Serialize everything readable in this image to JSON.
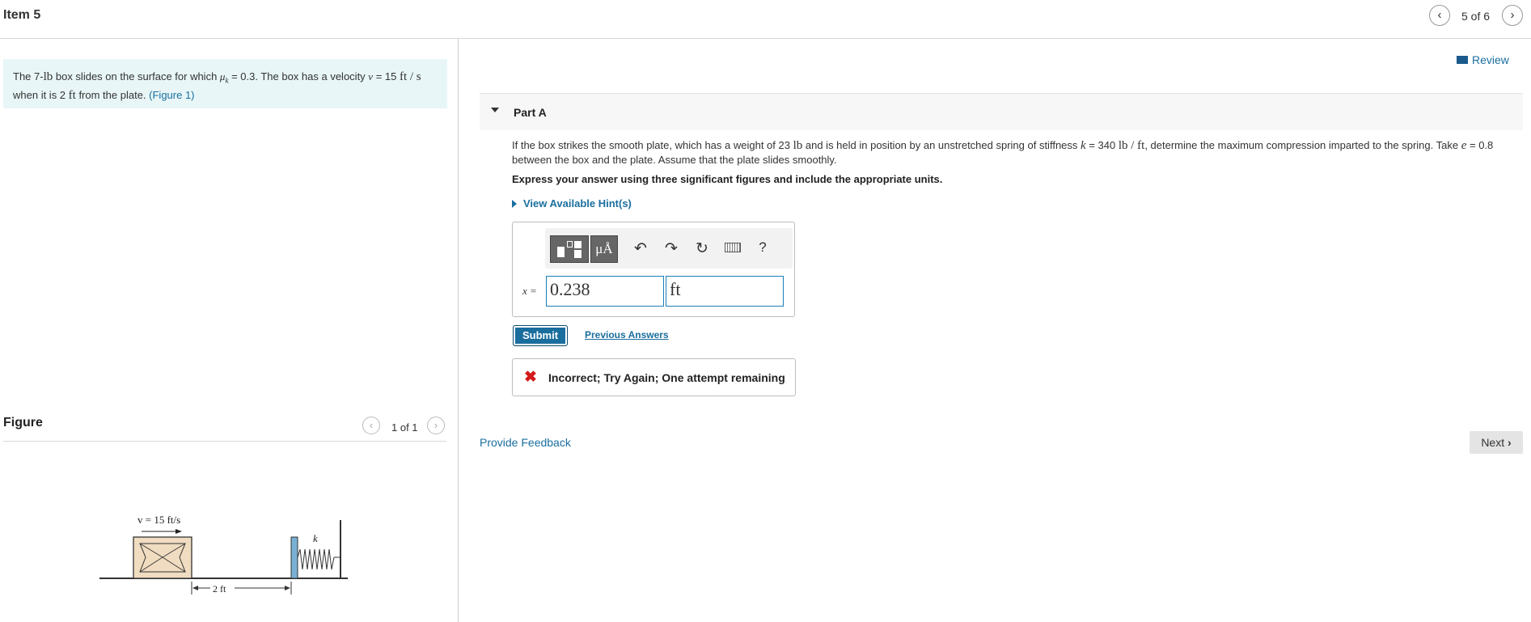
{
  "header": {
    "item_title": "Item 5",
    "pager": "5 of 6"
  },
  "problem": {
    "t1": "The 7-",
    "lb": "lb",
    "t2": " box slides on the surface for which ",
    "mu": "μ",
    "mu_sub": "k",
    "t3": " = 0.3. The box has a velocity ",
    "v": "v",
    "t4": " = 15 ",
    "unit": "ft / s",
    "t5": "when it is 2 ",
    "ft": "ft",
    "t6": " from the plate. ",
    "figure_link": "(Figure 1)"
  },
  "figure": {
    "title": "Figure",
    "pager": "1 of 1",
    "v_label": "v = 15 ft/s",
    "k_label": "k",
    "dist_label": "2 ft"
  },
  "review": "Review",
  "part": {
    "title": "Part A"
  },
  "question": {
    "q1": "If the box strikes the smooth plate, which has a weight of 23 ",
    "lb": "lb",
    "q2": " and is held in position by an unstretched spring of stiffness ",
    "k": "k",
    "q3": " = 340 ",
    "unit": "lb / ft",
    "q4": ", determine the maximum compression imparted to the spring. Take ",
    "e": "e",
    "q5": " = 0.8",
    "q6": "between the box and the plate. Assume that the plate slides smoothly.",
    "instructions": "Express your answer using three significant figures and include the appropriate units.",
    "hints": "View Available Hint(s)"
  },
  "answer": {
    "variable": "x =",
    "value": "0.238",
    "units": "ft",
    "toolbar": {
      "units_btn": "μÅ",
      "help": "?"
    }
  },
  "submit_label": "Submit",
  "previous_answers": "Previous Answers",
  "feedback": {
    "icon": "✖",
    "text": "Incorrect; Try Again; One attempt remaining"
  },
  "provide_feedback": "Provide Feedback",
  "next_label": "Next"
}
